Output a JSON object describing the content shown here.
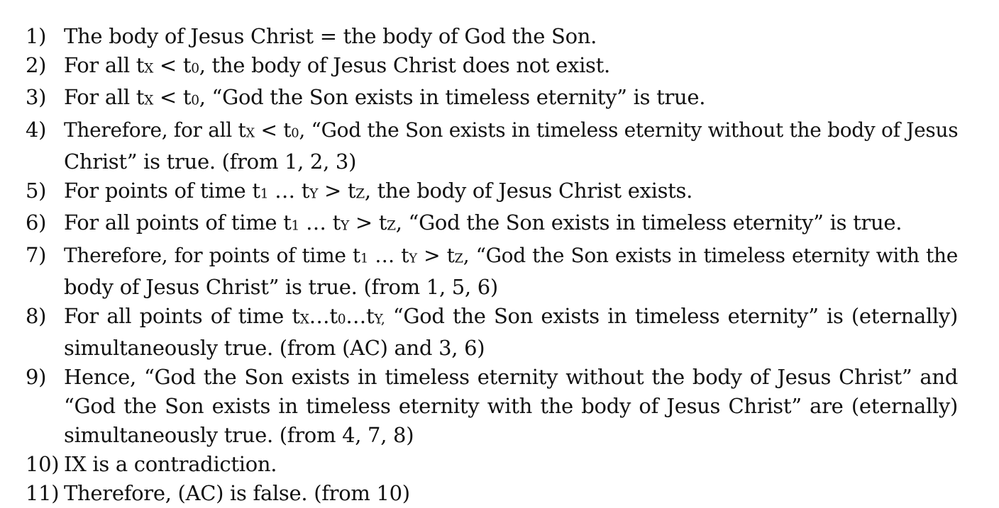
{
  "document": {
    "items": [
      {
        "number": "1)",
        "lines": [
          [
            [
              "t",
              "The body of Jesus Christ = the body of God the Son."
            ]
          ]
        ]
      },
      {
        "number": "2)",
        "lines": [
          [
            [
              "t",
              "For all t"
            ],
            [
              "s",
              "X"
            ],
            [
              "t",
              " < t"
            ],
            [
              "s",
              "0"
            ],
            [
              "t",
              ", the body of Jesus Christ does not exist."
            ]
          ]
        ]
      },
      {
        "number": "3)",
        "lines": [
          [
            [
              "t",
              "For all t"
            ],
            [
              "s",
              "X"
            ],
            [
              "t",
              " < t"
            ],
            [
              "s",
              "0"
            ],
            [
              "t",
              ", “God the Son exists in timeless eternity” is true."
            ]
          ]
        ]
      },
      {
        "number": "4)",
        "lines": [
          [
            [
              "t",
              "Therefore, for all t"
            ],
            [
              "s",
              "X"
            ],
            [
              "t",
              " < t"
            ],
            [
              "s",
              "0"
            ],
            [
              "t",
              ", “God the Son exists in timeless eternity without the body of Jesus"
            ]
          ],
          [
            [
              "t",
              "Christ” is true. (from 1, 2, 3)"
            ]
          ]
        ]
      },
      {
        "number": "5)",
        "lines": [
          [
            [
              "t",
              "For points of time t"
            ],
            [
              "s",
              "1"
            ],
            [
              "t",
              " … t"
            ],
            [
              "s",
              "Y"
            ],
            [
              "t",
              " > t"
            ],
            [
              "s",
              "Z"
            ],
            [
              "t",
              ", the body of Jesus Christ exists."
            ]
          ]
        ]
      },
      {
        "number": "6)",
        "lines": [
          [
            [
              "t",
              "For all points of time t"
            ],
            [
              "s",
              "1"
            ],
            [
              "t",
              " … t"
            ],
            [
              "s",
              "Y"
            ],
            [
              "t",
              " > t"
            ],
            [
              "s",
              "Z"
            ],
            [
              "t",
              ", “God the Son exists in timeless eternity” is true."
            ]
          ]
        ]
      },
      {
        "number": "7)",
        "lines": [
          [
            [
              "t",
              "Therefore, for points of time t"
            ],
            [
              "s",
              "1"
            ],
            [
              "t",
              " … t"
            ],
            [
              "s",
              "Y"
            ],
            [
              "t",
              " > t"
            ],
            [
              "s",
              "Z"
            ],
            [
              "t",
              ", “God the Son exists in timeless eternity with the"
            ]
          ],
          [
            [
              "t",
              "body of Jesus Christ” is true. (from 1, 5, 6)"
            ]
          ]
        ]
      },
      {
        "number": "8)",
        "lines": [
          [
            [
              "t",
              "For all points of time t"
            ],
            [
              "s",
              "X"
            ],
            [
              "t",
              "…t"
            ],
            [
              "s",
              "0"
            ],
            [
              "t",
              "…t"
            ],
            [
              "s",
              "Y,"
            ],
            [
              "t",
              " “God the Son exists in timeless eternity” is (eternally)"
            ]
          ],
          [
            [
              "t",
              "simultaneously true. (from (AC) and 3, 6)"
            ]
          ]
        ]
      },
      {
        "number": "9)",
        "lines": [
          [
            [
              "t",
              "Hence, “God the Son exists in timeless eternity without the body of Jesus Christ” and"
            ]
          ],
          [
            [
              "t",
              "“God the Son exists in timeless eternity with the body of Jesus Christ” are (eternally)"
            ]
          ],
          [
            [
              "t",
              "simultaneously true. (from 4, 7, 8)"
            ]
          ]
        ]
      },
      {
        "number": "10)",
        "lines": [
          [
            [
              "t",
              "IX is a contradiction."
            ]
          ]
        ]
      },
      {
        "number": "11)",
        "lines": [
          [
            [
              "t",
              "Therefore, (AC) is false. (from 10)"
            ]
          ]
        ]
      }
    ]
  }
}
